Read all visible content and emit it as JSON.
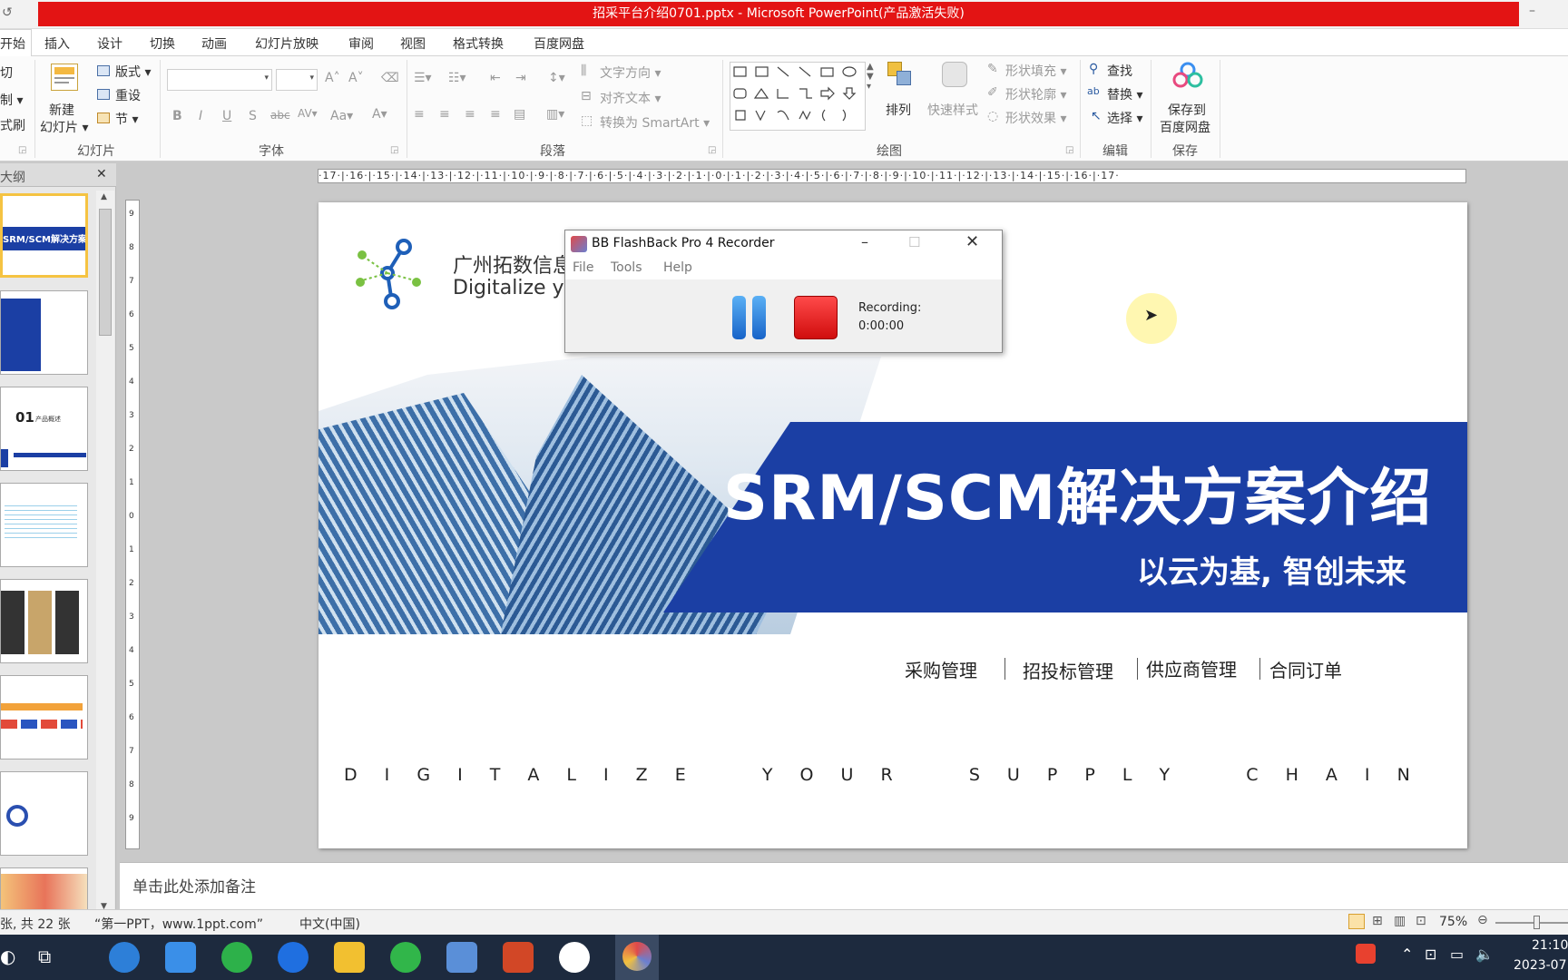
{
  "window": {
    "title": "招采平台介绍0701.pptx - Microsoft PowerPoint(产品激活失败)",
    "quick_access": "↺",
    "minimize": "–"
  },
  "tabs": [
    "开始",
    "插入",
    "设计",
    "切换",
    "动画",
    "幻灯片放映",
    "审阅",
    "视图",
    "格式转换",
    "百度网盘"
  ],
  "ribbon": {
    "clipboard": {
      "cut": "切",
      "copy": "制 ▾",
      "format_painter": "式刷"
    },
    "slides": {
      "new_slide_line1": "新建",
      "new_slide_line2": "幻灯片 ▾",
      "layout": "版式 ▾",
      "reset": "重设",
      "section": "节 ▾",
      "label": "幻灯片"
    },
    "font": {
      "label": "字体"
    },
    "paragraph": {
      "text_direction": "文字方向 ▾",
      "align_text": "对齐文本 ▾",
      "smartart": "转换为 SmartArt ▾",
      "label": "段落"
    },
    "drawing": {
      "arrange": "排列",
      "quick_styles": "快速样式",
      "shape_fill": "形状填充 ▾",
      "shape_outline": "形状轮廓 ▾",
      "shape_effects": "形状效果 ▾",
      "label": "绘图"
    },
    "editing": {
      "find": "查找",
      "replace": "替换 ▾",
      "select": "选择 ▾",
      "label": "编辑"
    },
    "save": {
      "line1": "保存到",
      "line2": "百度网盘",
      "label": "保存"
    }
  },
  "ruler": {
    "horizontal": "·17·|·16·|·15·|·14·|·13·|·12·|·11·|·10·|·9·|·8·|·7·|·6·|·5·|·4·|·3·|·2·|·1·|·0·|·1·|·2·|·3·|·4·|·5·|·6·|·7·|·8·|·9·|·10·|·11·|·12·|·13·|·14·|·15·|·16·|·17·",
    "vertical": [
      "9",
      "8",
      "7",
      "6",
      "5",
      "4",
      "3",
      "2",
      "1",
      "0",
      "1",
      "2",
      "3",
      "4",
      "5",
      "6",
      "7",
      "8",
      "9"
    ]
  },
  "left_panel": {
    "tab_label": "大纲",
    "close": "✕",
    "thumb_1_title": "SRM/SCM解决方案介绍",
    "thumb_3_title": "01",
    "thumb_3_sub": "产品概述"
  },
  "recorder": {
    "title": "BB FlashBack Pro 4 Recorder",
    "menu": [
      "File",
      "Tools",
      "Help"
    ],
    "status_label": "Recording:",
    "time": "0:00:00"
  },
  "slide": {
    "company_cn": "广州拓数信息",
    "company_en": "Digitalize yo",
    "title": "SRM/SCM解决方案介绍",
    "subtitle": "以云为基, 智创未来",
    "modules": [
      "采购管理",
      "招投标管理",
      "供应商管理",
      "合同订单"
    ],
    "tagline": "D I G I T A L I Z E    Y O U R    S U P P L Y    C H A I N"
  },
  "notes_placeholder": "单击此处添加备注",
  "status": {
    "slide_count": "张, 共 22 张",
    "theme": "“第一PPT，www.1ppt.com”",
    "language": "中文(中国)",
    "zoom": "75%"
  },
  "taskbar": {
    "time": "21:10",
    "date": "2023-07"
  },
  "colors": {
    "brand_blue": "#1b3fa4",
    "record_red": "#e01a1a",
    "title_red": "#e31414",
    "cursor_highlight": "#fff6a8"
  }
}
